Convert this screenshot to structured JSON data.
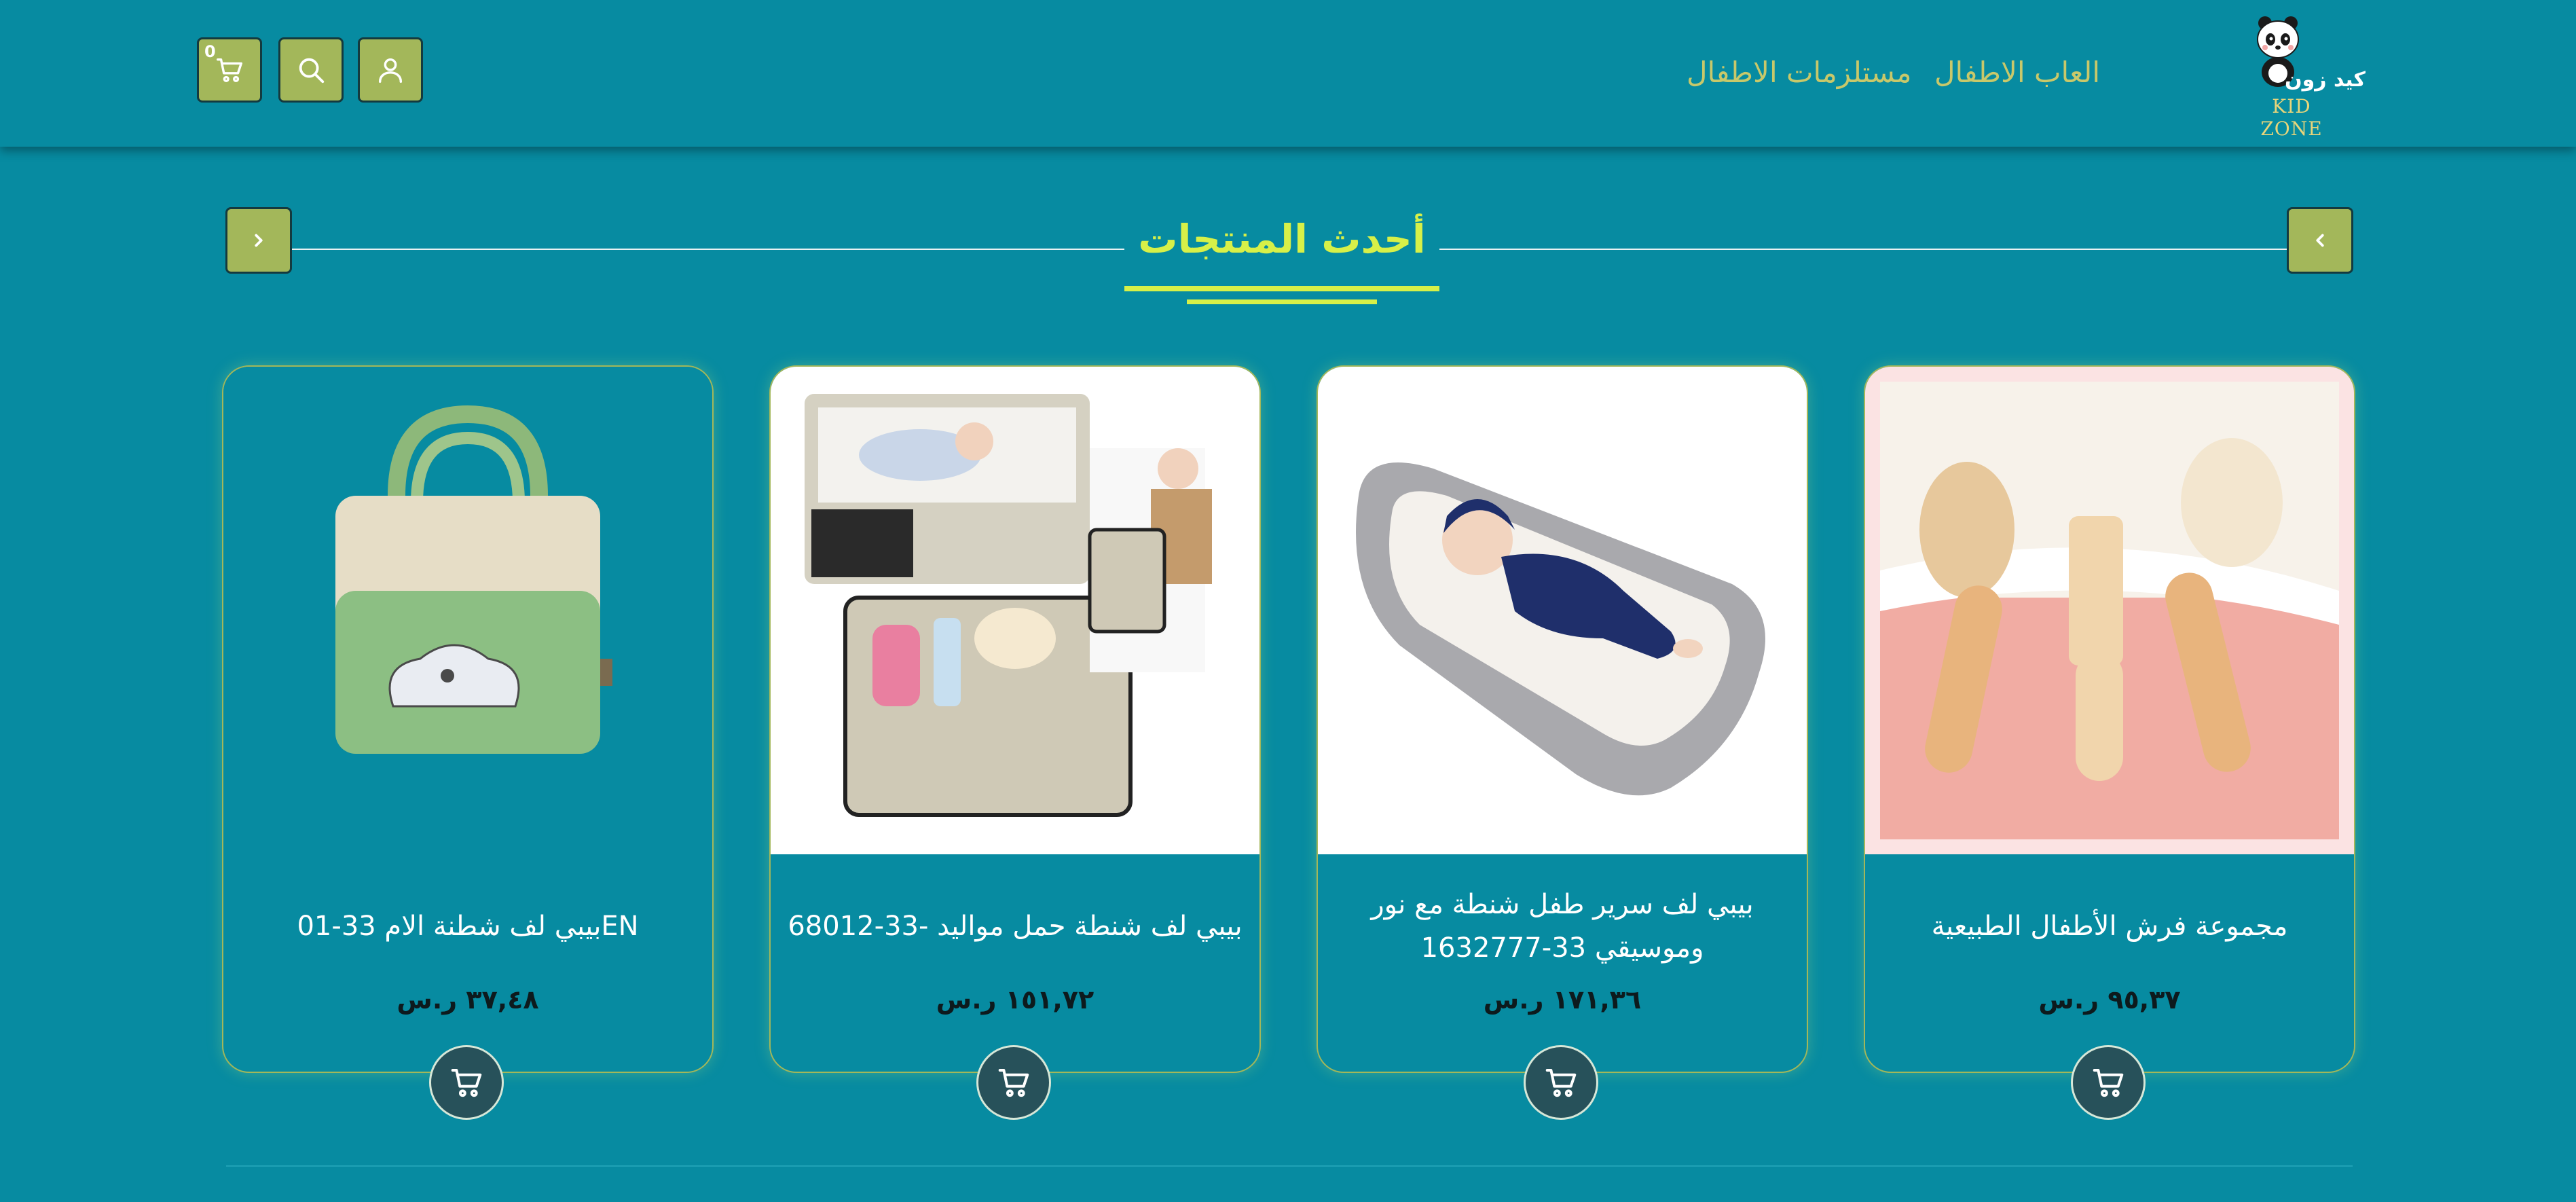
{
  "header": {
    "logo_text": "KID ZONE",
    "logo_arabic": "كيد زون",
    "nav": [
      {
        "label": "العاب الاطفال"
      },
      {
        "label": "مستلزمات الاطفال"
      }
    ],
    "cart_count": "0",
    "icons": {
      "cart": "cart-icon",
      "search": "search-icon",
      "user": "user-icon"
    }
  },
  "section": {
    "title": "أحدث المنتجات",
    "prev_icon": "chevron-left-icon",
    "next_icon": "chevron-right-icon"
  },
  "products": [
    {
      "title": "مجموعة فرش الأطفال الطبيعية",
      "price": "٩٥,٣٧ ر.س"
    },
    {
      "title": "بيبي لف سرير طفل شنطة مع نور وموسيقي 33-1632777",
      "price": "١٧١,٣٦ ر.س"
    },
    {
      "title": "بيبي لف شنطة حمل مواليد -33-68012",
      "price": "١٥١,٧٢ ر.س"
    },
    {
      "title": "بيبي لف شطنة الام 33-01EN",
      "price": "٣٧,٤٨ ر.س"
    }
  ],
  "colors": {
    "background": "#078ba1",
    "accent": "#a3b75a",
    "title": "#d7f048",
    "nav_text": "#c8c86a"
  }
}
